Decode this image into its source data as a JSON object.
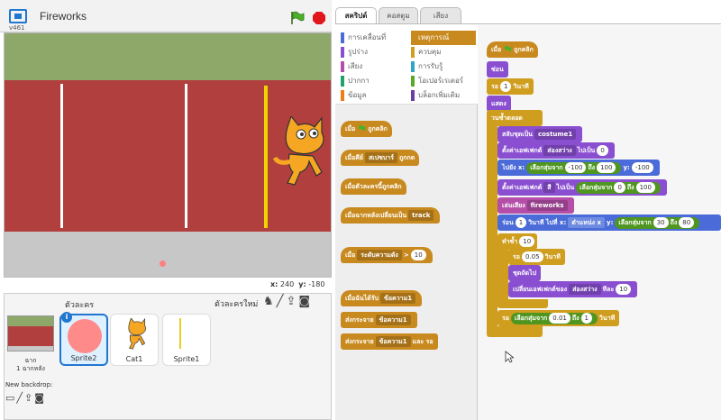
{
  "stage": {
    "version": "v461",
    "title": "Fireworks",
    "coords": {
      "x_label": "x:",
      "x": "240",
      "y_label": "y:",
      "y": "-180"
    }
  },
  "sprites_panel": {
    "title": "ตัวละคร",
    "new_sprite_label": "ตัวละครใหม่",
    "backdrop_label_1": "ฉาก",
    "backdrop_label_2": "1 ฉากหลัง",
    "new_backdrop_label": "New backdrop:",
    "sprites": [
      {
        "name": "Sprite2",
        "selected": true
      },
      {
        "name": "Cat1",
        "selected": false
      },
      {
        "name": "Sprite1",
        "selected": false
      }
    ]
  },
  "tabs": [
    "สคริปต์",
    "คอสตูม",
    "เสียง"
  ],
  "categories": {
    "left": [
      {
        "label": "การเคลื่อนที่",
        "color": "#4a6bd8"
      },
      {
        "label": "รูปร่าง",
        "color": "#8a4fd0"
      },
      {
        "label": "เสียง",
        "color": "#b54ea8"
      },
      {
        "label": "ปากกา",
        "color": "#1fa36a"
      },
      {
        "label": "ข้อมูล",
        "color": "#ee7d16"
      }
    ],
    "right": [
      {
        "label": "เหตุการณ์",
        "color": "#c88a1f",
        "selected": true
      },
      {
        "label": "ควบคุม",
        "color": "#d09e1e"
      },
      {
        "label": "การรับรู้",
        "color": "#2fa5c7"
      },
      {
        "label": "โอเปอร์เรเตอร์",
        "color": "#5ba726"
      },
      {
        "label": "บล็อกเพิ่มเติม",
        "color": "#6b3fa0"
      }
    ]
  },
  "palette": {
    "b1": {
      "pre": "เมื่อ",
      "post": "ถูกคลิก"
    },
    "b2": {
      "pre": "เมื่อคีย์",
      "dd": "สเปซบาร์",
      "post": "ถูกกด"
    },
    "b3": {
      "text": "เมื่อตัวละครนี้ถูกคลิก"
    },
    "b4": {
      "pre": "เมื่อฉากหลังเปลี่ยนเป็น",
      "dd": "track"
    },
    "b5": {
      "pre": "เมื่อ",
      "dd": "ระดับความดัง",
      "op": ">",
      "val": "10"
    },
    "b6": {
      "pre": "เมื่อฉันได้รับ",
      "dd": "ข้อความ1"
    },
    "b7": {
      "pre": "ส่งกระจาย",
      "dd": "ข้อความ1"
    },
    "b8": {
      "pre": "ส่งกระจาย",
      "dd": "ข้อความ1",
      "post": "และ รอ"
    }
  },
  "script": {
    "s1": {
      "pre": "เมื่อ",
      "post": "ถูกคลิก"
    },
    "s2": {
      "text": "ซ่อน"
    },
    "s3": {
      "pre": "รอ",
      "val": "1",
      "post": "วินาที"
    },
    "s4": {
      "text": "แสดง"
    },
    "s5": {
      "text": "วนซ้ำตลอด"
    },
    "s6": {
      "pre": "สลับชุดเป็น",
      "dd": "costume1"
    },
    "s7": {
      "pre": "ตั้งค่าเอฟเฟกต์",
      "dd": "ส่องสว่าง",
      "mid": "ไปเป็น",
      "val": "0"
    },
    "s8": {
      "pre": "ไปยัง",
      "x": "x:",
      "a": "เลือกสุ่มจาก",
      "v1": "-100",
      "b": "ถึง",
      "v2": "100",
      "y": "y:",
      "v3": "-100"
    },
    "s9": {
      "pre": "ตั้งค่าเอฟเฟกต์",
      "dd": "สี",
      "mid": "ไปเป็น",
      "a": "เลือกสุ่มจาก",
      "v1": "0",
      "b": "ถึง",
      "v2": "100"
    },
    "s10": {
      "pre": "เล่นเสียง",
      "dd": "fireworks"
    },
    "s11": {
      "pre": "ร่อน",
      "val": "1",
      "mid": "วินาที ไปที่ x:",
      "xp": "ตำแหน่ง x",
      "y": "y:",
      "a": "เลือกสุ่มจาก",
      "v1": "30",
      "b": "ถึง",
      "v2": "80"
    },
    "s12": {
      "pre": "ทำซ้ำ",
      "val": "10"
    },
    "s13": {
      "pre": "รอ",
      "val": "0.05",
      "post": "วินาที"
    },
    "s14": {
      "text": "ชุดถัดไป"
    },
    "s15": {
      "pre": "เปลี่ยนเอฟเฟกต์ของ",
      "dd": "ส่องสว่าง",
      "mid": "ทีละ",
      "val": "10"
    },
    "s16": {
      "pre": "รอ",
      "a": "เลือกสุ่มจาก",
      "v1": "0.01",
      "b": "ถึง",
      "v2": "1",
      "post": "วินาที"
    }
  }
}
